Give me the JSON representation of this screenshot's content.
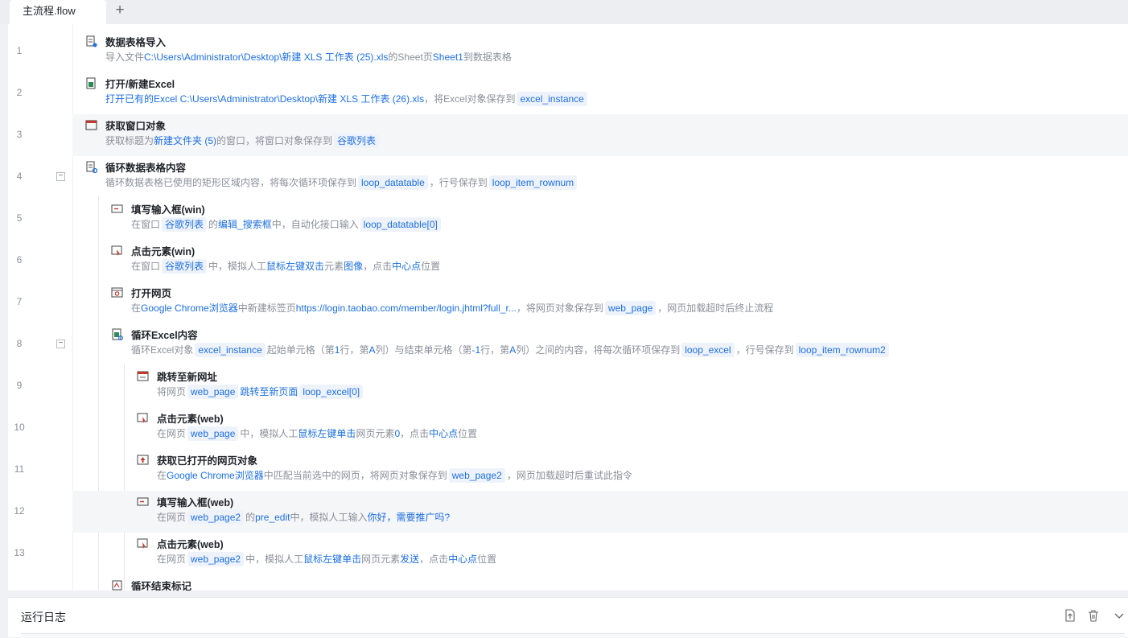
{
  "tabs": [
    {
      "label": "主流程.flow"
    }
  ],
  "add_tab_label": "+",
  "rows": [
    {
      "no": "1",
      "title": "数据表格导入",
      "icon": "datatable-import-icon"
    },
    {
      "no": "2",
      "title": "打开/新建Excel",
      "icon": "excel-open-icon"
    },
    {
      "no": "3",
      "title": "获取窗口对象",
      "icon": "window-icon"
    },
    {
      "no": "4",
      "title": "循环数据表格内容",
      "icon": "datatable-loop-icon"
    },
    {
      "no": "5",
      "title": "填写输入框(win)",
      "icon": "input-fill-icon"
    },
    {
      "no": "6",
      "title": "点击元素(win)",
      "icon": "click-element-icon"
    },
    {
      "no": "7",
      "title": "打开网页",
      "icon": "open-webpage-icon"
    },
    {
      "no": "8",
      "title": "循环Excel内容",
      "icon": "excel-loop-icon"
    },
    {
      "no": "9",
      "title": "跳转至新网址",
      "icon": "goto-url-icon"
    },
    {
      "no": "10",
      "title": "点击元素(web)",
      "icon": "click-element-icon"
    },
    {
      "no": "11",
      "title": "获取已打开的网页对象",
      "icon": "get-webpage-icon"
    },
    {
      "no": "12",
      "title": "填写输入框(web)",
      "icon": "input-fill-icon"
    },
    {
      "no": "13",
      "title": "点击元素(web)",
      "icon": "click-element-icon"
    },
    {
      "no": "",
      "title": "循环结束标记",
      "icon": "loop-end-icon"
    }
  ],
  "desc": {
    "r1": {
      "a": "导入文件",
      "b": "C:\\Users\\Administrator\\Desktop\\新建 XLS 工作表 (25).xls",
      "c": "的Sheet页",
      "d": "Sheet1",
      "e": "到数据表格"
    },
    "r2": {
      "a": "打开已有的Excel C:\\Users\\Administrator\\Desktop\\新建 XLS 工作表 (26).xls",
      "b": "，将Excel对象保存到",
      "c": "excel_instance"
    },
    "r3": {
      "a": "获取标题为",
      "b": "新建文件夹 (5)",
      "c": "的窗口，将窗口对象保存到",
      "d": "谷歌列表"
    },
    "r4": {
      "a": "循环数据表格已使用的矩形区域内容，将每次循环项保存到",
      "b": "loop_datatable",
      "c": "，行号保存到",
      "d": "loop_item_rownum"
    },
    "r5": {
      "a": "在窗口",
      "b": "谷歌列表",
      "c": "的",
      "d": "编辑_搜索框",
      "e": "中，自动化接口输入",
      "f": "loop_datatable[0]"
    },
    "r6": {
      "a": "在窗口",
      "b": "谷歌列表",
      "c": "中，模拟人工",
      "d": "鼠标左键双击",
      "e": "元素",
      "f": "图像",
      "g": "，点击",
      "h": "中心点",
      "i": "位置"
    },
    "r7": {
      "a": "在",
      "b": "Google Chrome浏览器",
      "c": "中新建标签页",
      "d": "https://login.taobao.com/member/login.jhtml?full_r...",
      "e": "，将网页对象保存到",
      "f": "web_page",
      "g": "，网页加载超时后终止流程"
    },
    "r8": {
      "a": "循环Excel对象",
      "b": "excel_instance",
      "c": "起始单元格（第",
      "d": "1",
      "e": "行，第",
      "f": "A",
      "g": "列）与结束单元格（第",
      "h": "-1",
      "i": "行，第",
      "j": "A",
      "k": "列）之间的内容，将每次循环项保存到",
      "l": "loop_excel",
      "m": "，行号保存到",
      "n": "loop_item_rownum2"
    },
    "r9": {
      "a": "将网页",
      "b": "web_page",
      "c": "跳转至新页面",
      "d": "loop_excel[0]"
    },
    "r10": {
      "a": "在网页",
      "b": "web_page",
      "c": "中，模拟人工",
      "d": "鼠标左键单击",
      "e": "网页元素",
      "f": "0",
      "g": "，点击",
      "h": "中心点",
      "i": "位置"
    },
    "r11": {
      "a": "在",
      "b": "Google Chrome浏览器",
      "c": "中匹配当前选中的网页，将网页对象保存到",
      "d": "web_page2",
      "e": "，网页加载超时后重试此指令"
    },
    "r12": {
      "a": "在网页",
      "b": "web_page2",
      "c": "的",
      "d": "pre_edit",
      "e": "中，模拟人工输入",
      "f": "你好，需要推广吗?"
    },
    "r13": {
      "a": "在网页",
      "b": "web_page2",
      "c": "中，模拟人工",
      "d": "鼠标左键单击",
      "e": "网页元素",
      "f": "发送",
      "g": "，点击",
      "h": "中心点",
      "i": "位置"
    }
  },
  "fold_symbol": "−",
  "log_panel": {
    "title": "运行日志"
  },
  "colors": {
    "accent": "#1d6fe0",
    "chip_bg": "#eef3fb",
    "highlight_row": "#f5f6f8"
  }
}
